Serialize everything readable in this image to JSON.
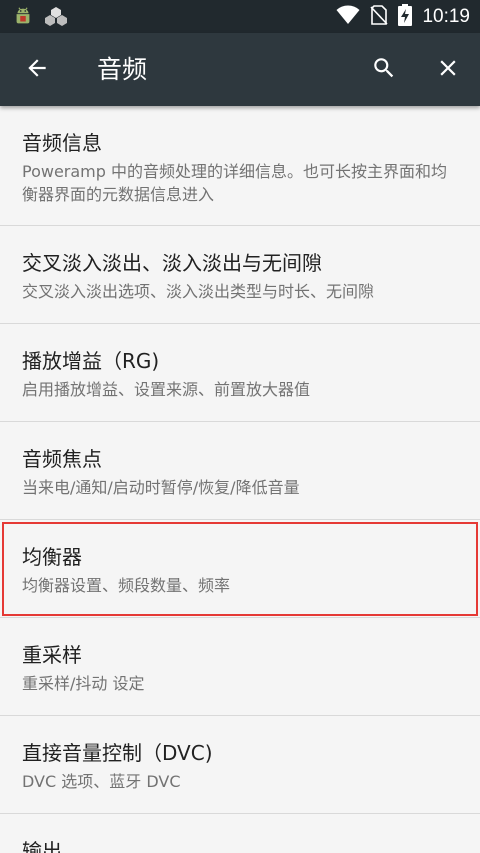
{
  "statusbar": {
    "time": "10:19",
    "icons": [
      "android-icon",
      "widget-icon",
      "wifi-icon",
      "no-sim-icon",
      "battery-charging-icon"
    ]
  },
  "appbar": {
    "title": "音频",
    "back_icon": "arrow-back-icon",
    "search_icon": "search-icon",
    "close_icon": "close-icon"
  },
  "settings": [
    {
      "title": "音频信息",
      "summary": "Poweramp 中的音频处理的详细信息。也可长按主界面和均衡器界面的元数据信息进入"
    },
    {
      "title": "交叉淡入淡出、淡入淡出与无间隙",
      "summary": "交叉淡入淡出选项、淡入淡出类型与时长、无间隙"
    },
    {
      "title": "播放增益（RG)",
      "summary": "启用播放增益、设置来源、前置放大器值"
    },
    {
      "title": "音频焦点",
      "summary": "当来电/通知/启动时暂停/恢复/降低音量"
    },
    {
      "title": "均衡器",
      "summary": "均衡器设置、频段数量、频率",
      "highlighted": true
    },
    {
      "title": "重采样",
      "summary": "重采样/抖动 设定"
    },
    {
      "title": "直接音量控制（DVC)",
      "summary": "DVC 选项、蓝牙 DVC"
    },
    {
      "title": "输出",
      "summary": ""
    }
  ],
  "colors": {
    "statusbar_bg": "#21292e",
    "appbar_bg": "#2e383e",
    "list_bg": "#f5f5f5",
    "highlight": "#e53935"
  }
}
